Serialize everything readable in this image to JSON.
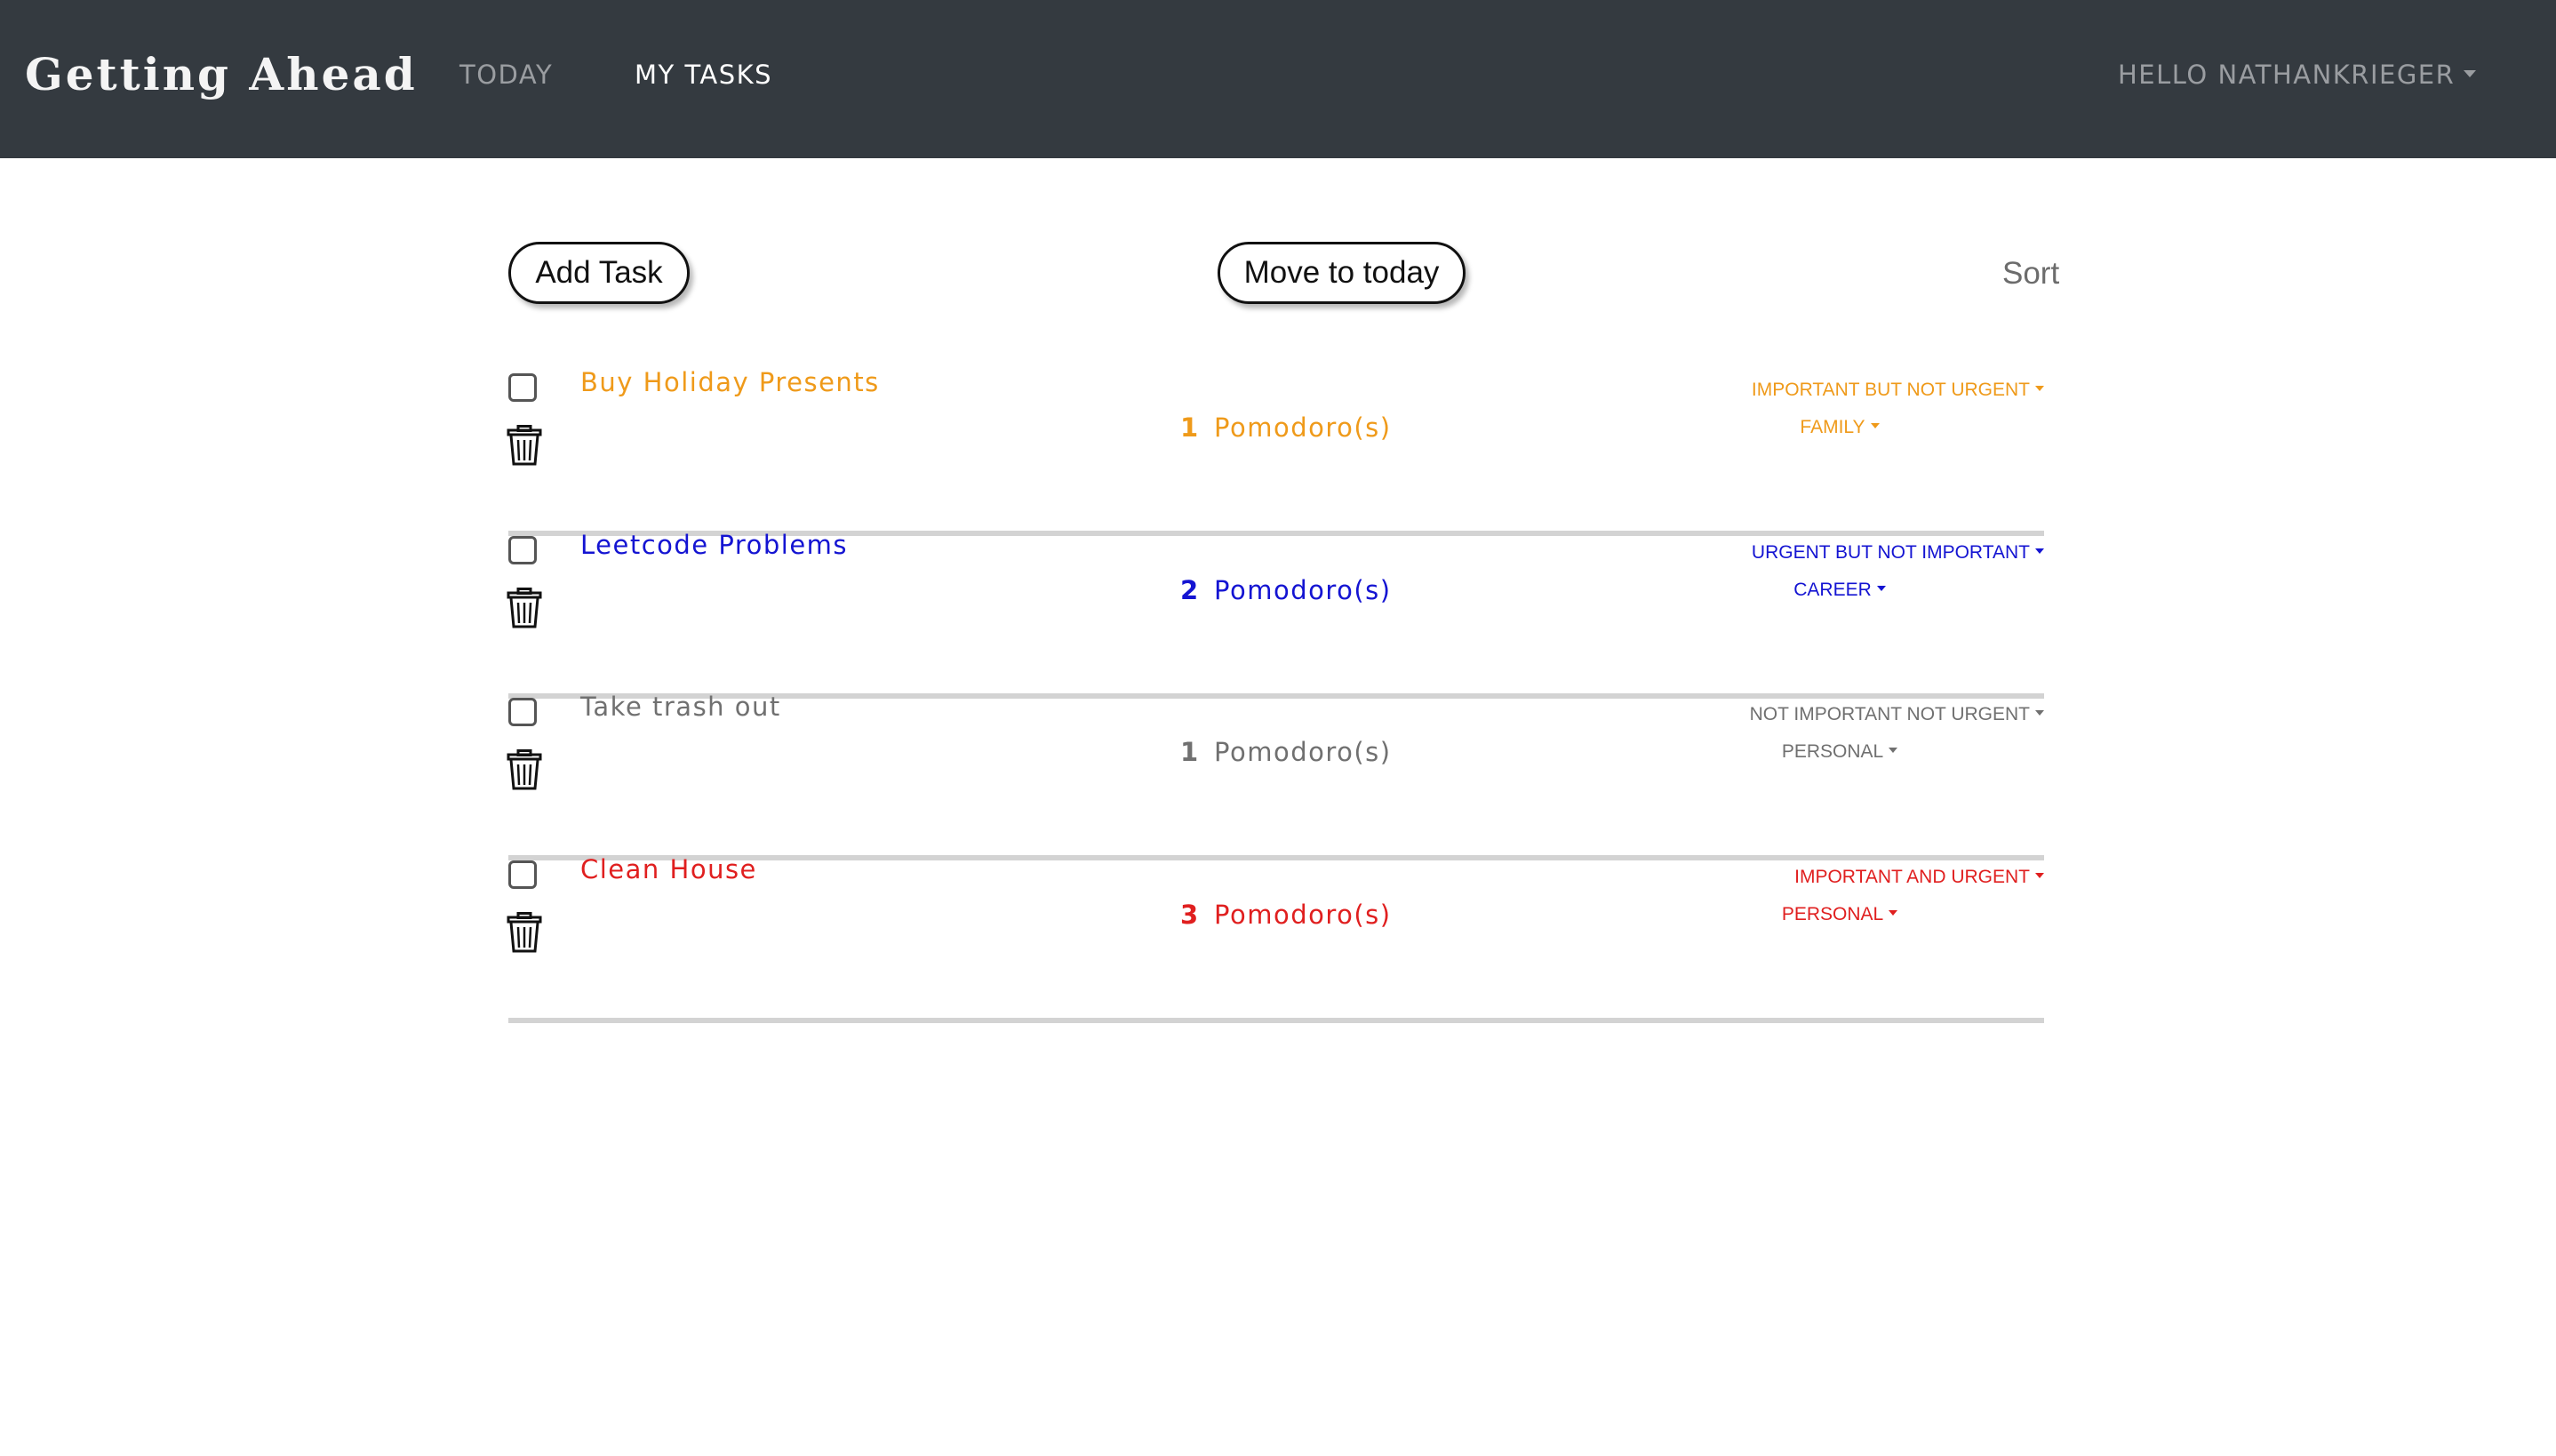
{
  "navbar": {
    "brand": "Getting Ahead",
    "links": [
      {
        "label": "TODAY"
      },
      {
        "label": "MY TASKS"
      }
    ],
    "user_menu": "HELLO NATHANKRIEGER"
  },
  "toolbar": {
    "add_label": "Add Task",
    "move_label": "Move to today",
    "sort_label": "Sort"
  },
  "colors": {
    "orange": "#ef9a1a",
    "blue": "#1414d2",
    "gray": "#707070",
    "red": "#e01f1f"
  },
  "pomodoro_suffix": "Pomodoro(s)",
  "tasks": [
    {
      "title": "Buy Holiday Presents",
      "pomodoros": "1",
      "priority": "IMPORTANT BUT NOT URGENT",
      "category": "FAMILY",
      "color": "#ef9a1a",
      "checked": false
    },
    {
      "title": "Leetcode Problems",
      "pomodoros": "2",
      "priority": "URGENT BUT NOT IMPORTANT",
      "category": "CAREER",
      "color": "#1414d2",
      "checked": false
    },
    {
      "title": "Take trash out",
      "pomodoros": "1",
      "priority": "NOT IMPORTANT NOT URGENT",
      "category": "PERSONAL",
      "color": "#707070",
      "checked": false
    },
    {
      "title": "Clean House",
      "pomodoros": "3",
      "priority": "IMPORTANT AND URGENT",
      "category": "PERSONAL",
      "color": "#e01f1f",
      "checked": false
    }
  ]
}
